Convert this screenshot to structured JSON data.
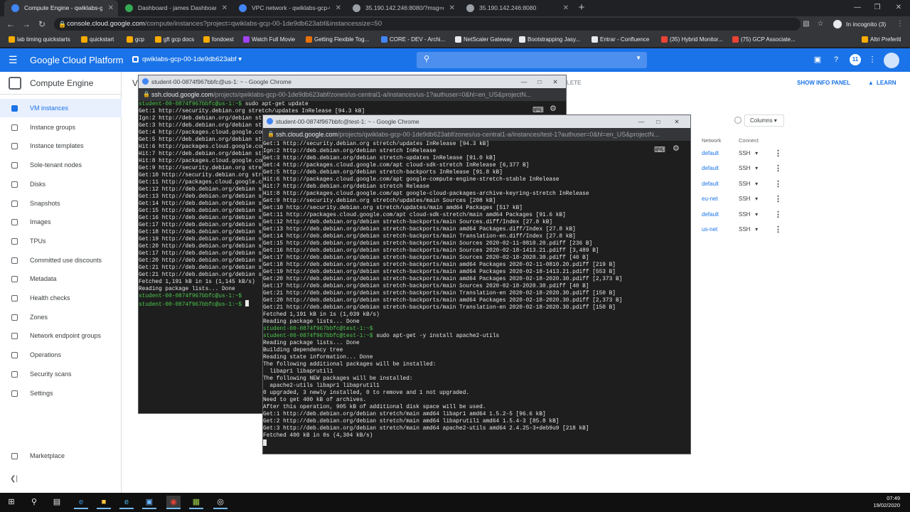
{
  "browser": {
    "tabs": [
      {
        "title": "Compute Engine - qwiklabs-gcp-",
        "active": true,
        "fav": "#4285f4"
      },
      {
        "title": "Dashboard - james Dashboard",
        "active": false,
        "fav": "#34a853"
      },
      {
        "title": "VPC network - qwiklabs-gcp-00-",
        "active": false,
        "fav": "#4285f4"
      },
      {
        "title": "35.190.142.246:8080/?msg=dog",
        "active": false,
        "fav": "#9aa0a6"
      },
      {
        "title": "35.190.142.246:8080",
        "active": false,
        "fav": "#9aa0a6"
      }
    ],
    "url_host": "console.cloud.google.com",
    "url_path": "/compute/instances?project=qwiklabs-gcp-00-1de9db623abf&instancessize=50",
    "incognito_label": "In incognito (3)",
    "bookmarks": [
      "lab timing quickstarts",
      "quickstart",
      "gcp",
      "gft gcp docs",
      "fondoest",
      "Watch Full Movie",
      "Getting Flexible Tog...",
      "CORE - DEV - Archi...",
      "NetScaler Gateway",
      "Bootstrapping Jasy...",
      "Entrar - Confluence",
      "(35) Hybrid Monitor...",
      "(75) GCP Associate..."
    ],
    "other_bookmarks": "Altri Preferiti"
  },
  "gcp": {
    "title": "Google Cloud Platform",
    "project": "qwiklabs-gcp-00-1de9db623abf",
    "notif_count": "11",
    "product": "Compute Engine",
    "page_title_fragment": "V",
    "show_info": "SHOW INFO PANEL",
    "learn": "LEARN",
    "delete_fragment": "LETE",
    "columns": "Columns",
    "col_network": "Network",
    "col_connect": "Connect",
    "rows": [
      {
        "network": "default",
        "connect": "SSH"
      },
      {
        "network": "default",
        "connect": "SSH"
      },
      {
        "network": "default",
        "connect": "SSH"
      },
      {
        "network": "eu-net",
        "connect": "SSH"
      },
      {
        "network": "default",
        "connect": "SSH"
      },
      {
        "network": "us-net",
        "connect": "SSH"
      }
    ],
    "sidebar": [
      "VM instances",
      "Instance groups",
      "Instance templates",
      "Sole-tenant nodes",
      "Disks",
      "Snapshots",
      "Images",
      "TPUs",
      "Committed use discounts",
      "Metadata",
      "Health checks",
      "Zones",
      "Network endpoint groups",
      "Operations",
      "Security scans",
      "Settings"
    ],
    "marketplace": "Marketplace"
  },
  "ssh1": {
    "title": "student-00-0874f967bbfc@us-1: ~ - Google Chrome",
    "url_host": "ssh.cloud.google.com",
    "url_path": "/projects/qwiklabs-gcp-00-1de9db623abf/zones/us-central1-a/instances/us-1?authuser=0&hl=en_US&projectN...",
    "prompt": "student-00-0874f967bbfc@us-1:~$",
    "lines": [
      {
        "p": "student-00-0874f967bbfc@us-1:~$",
        "t": " sudo apt-get update"
      },
      {
        "t": "Get:1 http://security.debian.org stretch/updates InRelease [94.3 kB]"
      },
      {
        "t": "Ign:2 http://deb.debian.org/debian stretch InRelease"
      },
      {
        "t": "Get:3 http://deb.debian.org/debian stretch-updates InRelease [91.0 kB]"
      },
      {
        "t": "Get:4 http://packages.cloud.google.com/apt cloud-sdk-stretch InRelease"
      },
      {
        "t": "Get:5 http://deb.debian.org/debian stretch-backports InRelease"
      },
      {
        "t": "Hit:6 http://packages.cloud.google.com/apt google-compute-engine"
      },
      {
        "t": "Hit:7 http://deb.debian.org/debian stretch Release"
      },
      {
        "t": "Hit:8 http://packages.cloud.google.com/apt google-cloud-packages"
      },
      {
        "t": "Get:9 http://security.debian.org stretch/updates/main Sources"
      },
      {
        "t": "Get:10 http://security.debian.org stretch/updates/main amd64"
      },
      {
        "t": "Get:11 http://packages.cloud.google.com/apt cloud-sdk-stretch"
      },
      {
        "t": "Get:12 http://deb.debian.org/debian stretch-backports/main"
      },
      {
        "t": "Get:13 http://deb.debian.org/debian stretch-backports/main"
      },
      {
        "t": "Get:14 http://deb.debian.org/debian stretch-backports/main"
      },
      {
        "t": "Get:15 http://deb.debian.org/debian stretch-backports/main"
      },
      {
        "t": "Get:16 http://deb.debian.org/debian stretch-backports/main"
      },
      {
        "t": "Get:17 http://deb.debian.org/debian stretch-backports/main"
      },
      {
        "t": "Get:18 http://deb.debian.org/debian stretch-backports/main"
      },
      {
        "t": "Get:19 http://deb.debian.org/debian stretch-backports/main"
      },
      {
        "t": "Get:20 http://deb.debian.org/debian stretch-backports/main"
      },
      {
        "t": "Get:17 http://deb.debian.org/debian stretch-backports/main"
      },
      {
        "t": "Get:20 http://deb.debian.org/debian stretch-backports/main"
      },
      {
        "t": "Get:21 http://deb.debian.org/debian stretch-backports/main"
      },
      {
        "t": "Get:21 http://deb.debian.org/debian stretch-backports/main"
      },
      {
        "t": "Fetched 1,191 kB in 1s (1,145 kB/s)"
      },
      {
        "t": "Reading package lists... Done"
      },
      {
        "p": "student-00-0874f967bbfc@us-1:~$",
        "t": ""
      },
      {
        "p": "student-00-0874f967bbfc@us-1:~$",
        "t": " "
      }
    ]
  },
  "ssh2": {
    "title": "student-00-0874f967bbfc@test-1: ~ - Google Chrome",
    "url_host": "ssh.cloud.google.com",
    "url_path": "/projects/qwiklabs-gcp-00-1de9db623abf/zones/us-central1-a/instances/test-1?authuser=0&hl=en_US&projectN...",
    "lines": [
      {
        "t": "Get:1 http://security.debian.org stretch/updates InRelease [94.3 kB]"
      },
      {
        "t": "Ign:2 http://deb.debian.org/debian stretch InRelease"
      },
      {
        "t": "Get:3 http://deb.debian.org/debian stretch-updates InRelease [91.0 kB]"
      },
      {
        "t": "Get:4 http://packages.cloud.google.com/apt cloud-sdk-stretch InRelease [6,377 B]"
      },
      {
        "t": "Get:5 http://deb.debian.org/debian stretch-backports InRelease [91.8 kB]"
      },
      {
        "t": "Hit:6 http://packages.cloud.google.com/apt google-compute-engine-stretch-stable InRelease"
      },
      {
        "t": "Hit:7 http://deb.debian.org/debian stretch Release"
      },
      {
        "t": "Hit:8 http://packages.cloud.google.com/apt google-cloud-packages-archive-keyring-stretch InRelease"
      },
      {
        "t": "Get:9 http://security.debian.org stretch/updates/main Sources [208 kB]"
      },
      {
        "t": "Get:10 http://security.debian.org stretch/updates/main amd64 Packages [517 kB]"
      },
      {
        "t": "Get:11 http://packages.cloud.google.com/apt cloud-sdk-stretch/main amd64 Packages [91.6 kB]"
      },
      {
        "t": "Get:12 http://deb.debian.org/debian stretch-backports/main Sources.diff/Index [27.8 kB]"
      },
      {
        "t": "Get:13 http://deb.debian.org/debian stretch-backports/main amd64 Packages.diff/Index [27.8 kB]"
      },
      {
        "t": "Get:14 http://deb.debian.org/debian stretch-backports/main Translation-en.diff/Index [27.8 kB]"
      },
      {
        "t": "Get:15 http://deb.debian.org/debian stretch-backports/main Sources 2020-02-11-0810.20.pdiff [236 B]"
      },
      {
        "t": "Get:16 http://deb.debian.org/debian stretch-backports/main Sources 2020-02-18-1413.21.pdiff [3,489 B]"
      },
      {
        "t": "Get:17 http://deb.debian.org/debian stretch-backports/main Sources 2020-02-18-2020.30.pdiff [40 B]"
      },
      {
        "t": "Get:18 http://deb.debian.org/debian stretch-backports/main amd64 Packages 2020-02-11-0810.20.pdiff [219 B]"
      },
      {
        "t": "Get:19 http://deb.debian.org/debian stretch-backports/main amd64 Packages 2020-02-18-1413.21.pdiff [553 B]"
      },
      {
        "t": "Get:20 http://deb.debian.org/debian stretch-backports/main amd64 Packages 2020-02-18-2020.30.pdiff [2,373 B]"
      },
      {
        "t": "Get:17 http://deb.debian.org/debian stretch-backports/main Sources 2020-02-18-2020.30.pdiff [40 B]"
      },
      {
        "t": "Get:21 http://deb.debian.org/debian stretch-backports/main Translation-en 2020-02-18-2020.30.pdiff [150 B]"
      },
      {
        "t": "Get:20 http://deb.debian.org/debian stretch-backports/main amd64 Packages 2020-02-18-2020.30.pdiff [2,373 B]"
      },
      {
        "t": "Get:21 http://deb.debian.org/debian stretch-backports/main Translation-en 2020-02-18-2020.30.pdiff [150 B]"
      },
      {
        "t": "Fetched 1,191 kB in 1s (1,039 kB/s)"
      },
      {
        "t": "Reading package lists... Done"
      },
      {
        "p": "student-00-0874f967bbfc@test-1:~$",
        "t": ""
      },
      {
        "p": "student-00-0874f967bbfc@test-1:~$",
        "t": " sudo apt-get -y install apache2-utils"
      },
      {
        "t": "Reading package lists... Done"
      },
      {
        "t": "Building dependency tree"
      },
      {
        "t": "Reading state information... Done"
      },
      {
        "t": "The following additional packages will be installed:"
      },
      {
        "t": "  libapr1 libaprutil1"
      },
      {
        "t": "The following NEW packages will be installed:"
      },
      {
        "t": "  apache2-utils libapr1 libaprutil1"
      },
      {
        "t": "0 upgraded, 3 newly installed, 0 to remove and 1 not upgraded."
      },
      {
        "t": "Need to get 400 kB of archives."
      },
      {
        "t": "After this operation, 905 kB of additional disk space will be used."
      },
      {
        "t": "Get:1 http://deb.debian.org/debian stretch/main amd64 libapr1 amd64 1.5.2-5 [96.6 kB]"
      },
      {
        "t": "Get:2 http://deb.debian.org/debian stretch/main amd64 libaprutil1 amd64 1.5.4-3 [85.8 kB]"
      },
      {
        "t": "Get:3 http://deb.debian.org/debian stretch/main amd64 apache2-utils amd64 2.4.25-3+deb9u9 [218 kB]"
      },
      {
        "t": "Fetched 400 kB in 0s (4,304 kB/s)"
      },
      {
        "t": ""
      }
    ]
  },
  "taskbar": {
    "time": "07:49",
    "date": "19/02/2020"
  }
}
